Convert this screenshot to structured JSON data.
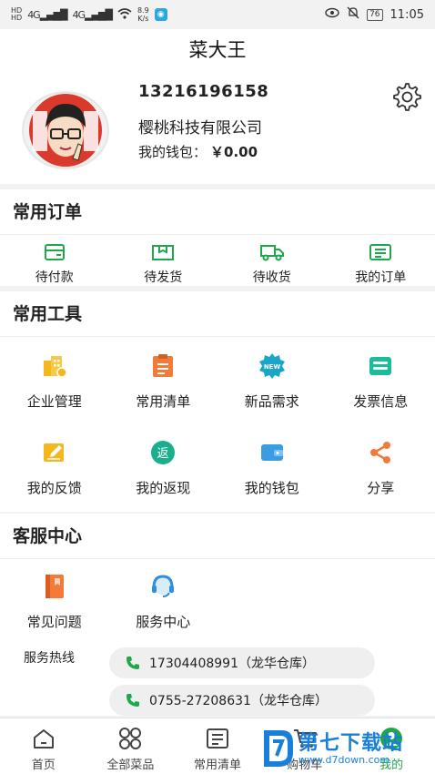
{
  "statusbar": {
    "hd1": "HD",
    "hd2": "HD",
    "sig1": "4G",
    "sig2": "4G",
    "speed_value": "8.9",
    "speed_unit": "K/s",
    "battery": "76",
    "time": "11:05"
  },
  "header": {
    "title": "菜大王"
  },
  "profile": {
    "phone": "13216196158",
    "company": "樱桃科技有限公司",
    "wallet_label": "我的钱包：",
    "wallet_value": "￥0.00"
  },
  "orders": {
    "title": "常用订单",
    "items": [
      {
        "label": "待付款",
        "icon": "wallet-card-icon"
      },
      {
        "label": "待发货",
        "icon": "box-icon"
      },
      {
        "label": "待收货",
        "icon": "truck-icon"
      },
      {
        "label": "我的订单",
        "icon": "order-list-icon"
      }
    ]
  },
  "tools": {
    "title": "常用工具",
    "items": [
      {
        "label": "企业管理",
        "icon": "building-icon"
      },
      {
        "label": "常用清单",
        "icon": "clipboard-icon"
      },
      {
        "label": "新品需求",
        "icon": "new-badge-icon",
        "badge": "NEW"
      },
      {
        "label": "发票信息",
        "icon": "invoice-icon"
      },
      {
        "label": "我的反馈",
        "icon": "edit-icon"
      },
      {
        "label": "我的返现",
        "icon": "cashback-icon",
        "badge": "返"
      },
      {
        "label": "我的钱包",
        "icon": "wallet-icon"
      },
      {
        "label": "分享",
        "icon": "share-icon"
      }
    ]
  },
  "service": {
    "title": "客服中心",
    "items": [
      {
        "label": "常见问题",
        "icon": "book-icon"
      },
      {
        "label": "服务中心",
        "icon": "headset-icon"
      }
    ],
    "hotline_label": "服务热线",
    "hotlines": [
      "17304408991（龙华仓库）",
      "0755-27208631（龙华仓库）"
    ]
  },
  "tabbar": {
    "items": [
      {
        "label": "首页",
        "icon": "home-icon"
      },
      {
        "label": "全部菜品",
        "icon": "grid-icon"
      },
      {
        "label": "常用清单",
        "icon": "list-icon"
      },
      {
        "label": "购物车",
        "icon": "cart-icon"
      },
      {
        "label": "我的",
        "icon": "profile-icon"
      }
    ],
    "active": "我的"
  },
  "watermark": {
    "text": "第七下载站",
    "url": "www.d7down.com"
  },
  "colors": {
    "green": "#1ea84b",
    "orange": "#f47a3a",
    "yellow": "#f5b81c",
    "teal": "#1abc9c",
    "blue": "#1a7fd9"
  }
}
